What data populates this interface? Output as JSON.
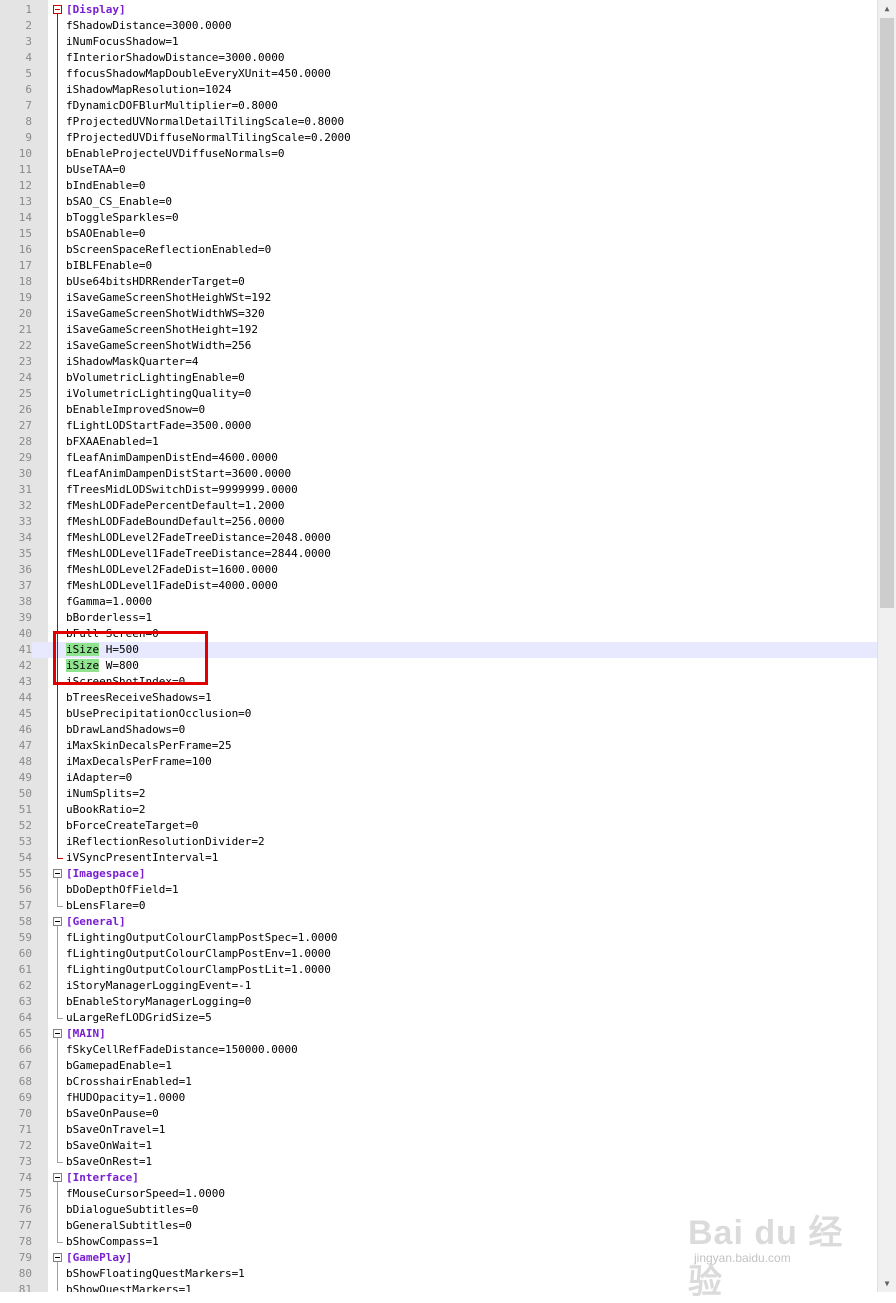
{
  "editor": {
    "lines": [
      {
        "n": "1",
        "t": "[Display]",
        "hdr": true
      },
      {
        "n": "2",
        "t": "fShadowDistance=3000.0000"
      },
      {
        "n": "3",
        "t": "iNumFocusShadow=1"
      },
      {
        "n": "4",
        "t": "fInteriorShadowDistance=3000.0000"
      },
      {
        "n": "5",
        "t": "ffocusShadowMapDoubleEveryXUnit=450.0000"
      },
      {
        "n": "6",
        "t": "iShadowMapResolution=1024"
      },
      {
        "n": "7",
        "t": "fDynamicDOFBlurMultiplier=0.8000"
      },
      {
        "n": "8",
        "t": "fProjectedUVNormalDetailTilingScale=0.8000"
      },
      {
        "n": "9",
        "t": "fProjectedUVDiffuseNormalTilingScale=0.2000"
      },
      {
        "n": "10",
        "t": "bEnableProjecteUVDiffuseNormals=0"
      },
      {
        "n": "11",
        "t": "bUseTAA=0"
      },
      {
        "n": "12",
        "t": "bIndEnable=0"
      },
      {
        "n": "13",
        "t": "bSAO_CS_Enable=0"
      },
      {
        "n": "14",
        "t": "bToggleSparkles=0"
      },
      {
        "n": "15",
        "t": "bSAOEnable=0"
      },
      {
        "n": "16",
        "t": "bScreenSpaceReflectionEnabled=0"
      },
      {
        "n": "17",
        "t": "bIBLFEnable=0"
      },
      {
        "n": "18",
        "t": "bUse64bitsHDRRenderTarget=0"
      },
      {
        "n": "19",
        "t": "iSaveGameScreenShotHeighWSt=192"
      },
      {
        "n": "20",
        "t": "iSaveGameScreenShotWidthWS=320"
      },
      {
        "n": "21",
        "t": "iSaveGameScreenShotHeight=192"
      },
      {
        "n": "22",
        "t": "iSaveGameScreenShotWidth=256"
      },
      {
        "n": "23",
        "t": "iShadowMaskQuarter=4"
      },
      {
        "n": "24",
        "t": "bVolumetricLightingEnable=0"
      },
      {
        "n": "25",
        "t": "iVolumetricLightingQuality=0"
      },
      {
        "n": "26",
        "t": "bEnableImprovedSnow=0"
      },
      {
        "n": "27",
        "t": "fLightLODStartFade=3500.0000"
      },
      {
        "n": "28",
        "t": "bFXAAEnabled=1"
      },
      {
        "n": "29",
        "t": "fLeafAnimDampenDistEnd=4600.0000"
      },
      {
        "n": "30",
        "t": "fLeafAnimDampenDistStart=3600.0000"
      },
      {
        "n": "31",
        "t": "fTreesMidLODSwitchDist=9999999.0000"
      },
      {
        "n": "32",
        "t": "fMeshLODFadePercentDefault=1.2000"
      },
      {
        "n": "33",
        "t": "fMeshLODFadeBoundDefault=256.0000"
      },
      {
        "n": "34",
        "t": "fMeshLODLevel2FadeTreeDistance=2048.0000"
      },
      {
        "n": "35",
        "t": "fMeshLODLevel1FadeTreeDistance=2844.0000"
      },
      {
        "n": "36",
        "t": "fMeshLODLevel2FadeDist=1600.0000"
      },
      {
        "n": "37",
        "t": "fMeshLODLevel1FadeDist=4000.0000"
      },
      {
        "n": "38",
        "t": "fGamma=1.0000"
      },
      {
        "n": "39",
        "t": "bBorderless=1"
      },
      {
        "n": "40",
        "t": "bFull Screen=0"
      },
      {
        "n": "41",
        "hl": "iSize",
        "t": " H=500"
      },
      {
        "n": "42",
        "hl": "iSize",
        "t": " W=800"
      },
      {
        "n": "43",
        "t": "iScreenShotIndex=0"
      },
      {
        "n": "44",
        "t": "bTreesReceiveShadows=1"
      },
      {
        "n": "45",
        "t": "bUsePrecipitationOcclusion=0"
      },
      {
        "n": "46",
        "t": "bDrawLandShadows=0"
      },
      {
        "n": "47",
        "t": "iMaxSkinDecalsPerFrame=25"
      },
      {
        "n": "48",
        "t": "iMaxDecalsPerFrame=100"
      },
      {
        "n": "49",
        "t": "iAdapter=0"
      },
      {
        "n": "50",
        "t": "iNumSplits=2"
      },
      {
        "n": "51",
        "t": "uBookRatio=2"
      },
      {
        "n": "52",
        "t": "bForceCreateTarget=0"
      },
      {
        "n": "53",
        "t": "iReflectionResolutionDivider=2"
      },
      {
        "n": "54",
        "t": "iVSyncPresentInterval=1"
      },
      {
        "n": "55",
        "t": "[Imagespace]",
        "hdr": true
      },
      {
        "n": "56",
        "t": "bDoDepthOfField=1"
      },
      {
        "n": "57",
        "t": "bLensFlare=0"
      },
      {
        "n": "58",
        "t": "[General]",
        "hdr": true
      },
      {
        "n": "59",
        "t": "fLightingOutputColourClampPostSpec=1.0000"
      },
      {
        "n": "60",
        "t": "fLightingOutputColourClampPostEnv=1.0000"
      },
      {
        "n": "61",
        "t": "fLightingOutputColourClampPostLit=1.0000"
      },
      {
        "n": "62",
        "t": "iStoryManagerLoggingEvent=-1"
      },
      {
        "n": "63",
        "t": "bEnableStoryManagerLogging=0"
      },
      {
        "n": "64",
        "t": "uLargeRefLODGridSize=5"
      },
      {
        "n": "65",
        "t": "[MAIN]",
        "hdr": true
      },
      {
        "n": "66",
        "t": "fSkyCellRefFadeDistance=150000.0000"
      },
      {
        "n": "67",
        "t": "bGamepadEnable=1"
      },
      {
        "n": "68",
        "t": "bCrosshairEnabled=1"
      },
      {
        "n": "69",
        "t": "fHUDOpacity=1.0000"
      },
      {
        "n": "70",
        "t": "bSaveOnPause=0"
      },
      {
        "n": "71",
        "t": "bSaveOnTravel=1"
      },
      {
        "n": "72",
        "t": "bSaveOnWait=1"
      },
      {
        "n": "73",
        "t": "bSaveOnRest=1"
      },
      {
        "n": "74",
        "t": "[Interface]",
        "hdr": true
      },
      {
        "n": "75",
        "t": "fMouseCursorSpeed=1.0000"
      },
      {
        "n": "76",
        "t": "bDialogueSubtitles=0"
      },
      {
        "n": "77",
        "t": "bGeneralSubtitles=0"
      },
      {
        "n": "78",
        "t": "bShowCompass=1"
      },
      {
        "n": "79",
        "t": "[GamePlay]",
        "hdr": true
      },
      {
        "n": "80",
        "t": "bShowFloatingQuestMarkers=1"
      },
      {
        "n": "81",
        "t": "bShowQuestMarkers=1"
      }
    ],
    "current_line": "41",
    "colors": {
      "section": "#7a1fd0",
      "highlight": "#8fe38f",
      "annotation": "#e00000",
      "fold_active": "#d00000"
    }
  },
  "scrollbar": {
    "up_icon": "▲",
    "down_icon": "▼"
  },
  "watermark": {
    "main": "Bai du 经验",
    "sub": "jingyan.baidu.com"
  }
}
